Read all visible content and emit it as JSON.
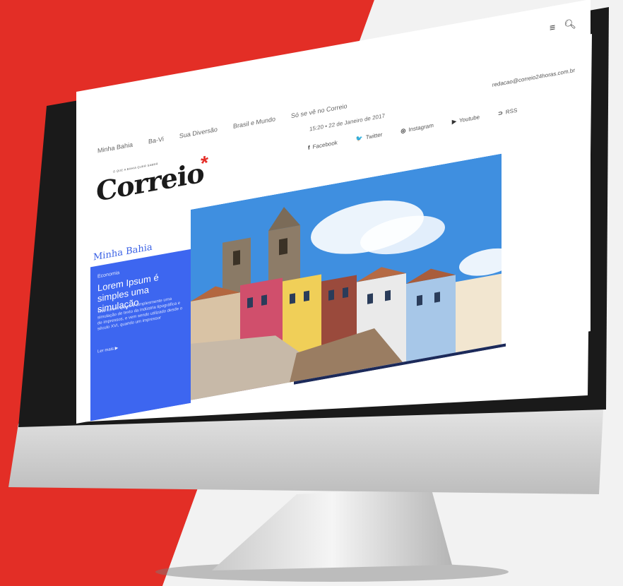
{
  "site": {
    "logo": "Correio",
    "logo_mark": "*",
    "tagline": "O QUE A BAHIA QUER SABER"
  },
  "nav": [
    "Minha Bahia",
    "Ba-Vi",
    "Sua Diversão",
    "Brasil e Mundo",
    "Só se vê no Correio"
  ],
  "header": {
    "datetime": "15:20 • 22 de Janeiro de 2017",
    "email": "redacao@correio24horas.com.br",
    "menu_icon": "hamburger-menu-icon",
    "search_icon": "search-icon"
  },
  "social": [
    {
      "icon": "f",
      "label": "Facebook"
    },
    {
      "icon": "🐦",
      "label": "Twitter"
    },
    {
      "icon": "◎",
      "label": "Instagram"
    },
    {
      "icon": "▶",
      "label": "Youtube"
    },
    {
      "icon": "⊃",
      "label": "RSS"
    }
  ],
  "section": {
    "title": "Minha Bahia"
  },
  "feature": {
    "category": "Economia",
    "headline": "Lorem Ipsum é simples uma simulação",
    "excerpt": "This Lorem Ipsum é simplesmente uma simulação de texto da indústria tipográfica e de impressos, e vem sendo utilizado desde o século XVI, quando um impressor",
    "read_more": "Ler mais ▶"
  },
  "colors": {
    "brand_red": "#e52d27",
    "accent_blue": "#3d66f0"
  }
}
